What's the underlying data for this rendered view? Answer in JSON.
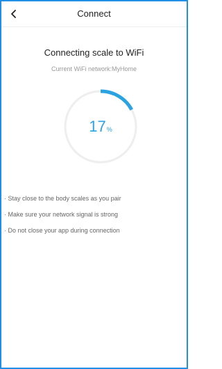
{
  "header": {
    "title": "Connect",
    "back_icon": "chevron-left-icon"
  },
  "main": {
    "title": "Connecting scale to WiFi",
    "subtitle": "Current WiFi network:MyHome",
    "progress": {
      "value": "17",
      "unit": "%",
      "fraction": 0.17
    },
    "tips": [
      "· Stay close to the body scales as you pair",
      "· Make sure your network signal is strong",
      "· Do not close your app during connection"
    ]
  },
  "colors": {
    "accent": "#2ba3e0",
    "track": "#eeeeee",
    "frame": "#1f8fe8"
  }
}
